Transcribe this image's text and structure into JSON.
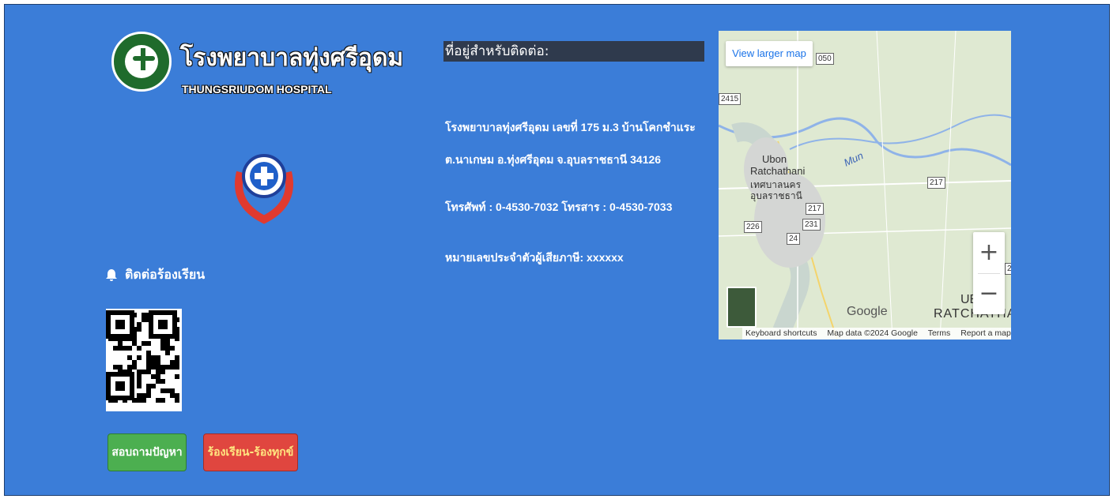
{
  "hospital": {
    "name_th": "โรงพยาบาลทุ่งศรีอุดม",
    "name_en": "THUNGSRIUDOM HOSPITAL"
  },
  "complaint": {
    "heading": "ติดต่อร้องเรียน",
    "ask_button": "สอบถามปัญหา",
    "complaint_button": "ร้องเรียน-ร้องทุกข์"
  },
  "contact": {
    "title": "ที่อยู่สำหรับติดต่อ:",
    "address_line1": "โรงพยาบาลทุ่งศรีอุดม  เลขที่ 175  ม.3 บ้านโคกชำแระ",
    "address_line2": "ต.นาเกษม อ.ทุ่งศรีอุดม จ.อุบลราชธานี 34126",
    "phone": "โทรศัพท์ : 0-4530-7032 โทรสาร : 0-4530-7033",
    "tax_id": "หมายเลขประจำตัวผู้เสียภาษี: xxxxxx"
  },
  "map": {
    "view_larger": "View larger map",
    "zoom_in": "+",
    "zoom_out": "−",
    "google": "Google",
    "city_en": "Ubon",
    "city_en2": "Ratchathani",
    "city_th": "เทศบาลนคร",
    "city_th2": "อุบลราชธานี",
    "river": "Mun",
    "province": "RATCHATHA",
    "province_partial": "UB",
    "roads": [
      "050",
      "2415",
      "217",
      "217",
      "226",
      "231",
      "24",
      "2"
    ],
    "footer": {
      "shortcuts": "Keyboard shortcuts",
      "data": "Map data ©2024 Google",
      "terms": "Terms",
      "report": "Report a map error"
    }
  }
}
